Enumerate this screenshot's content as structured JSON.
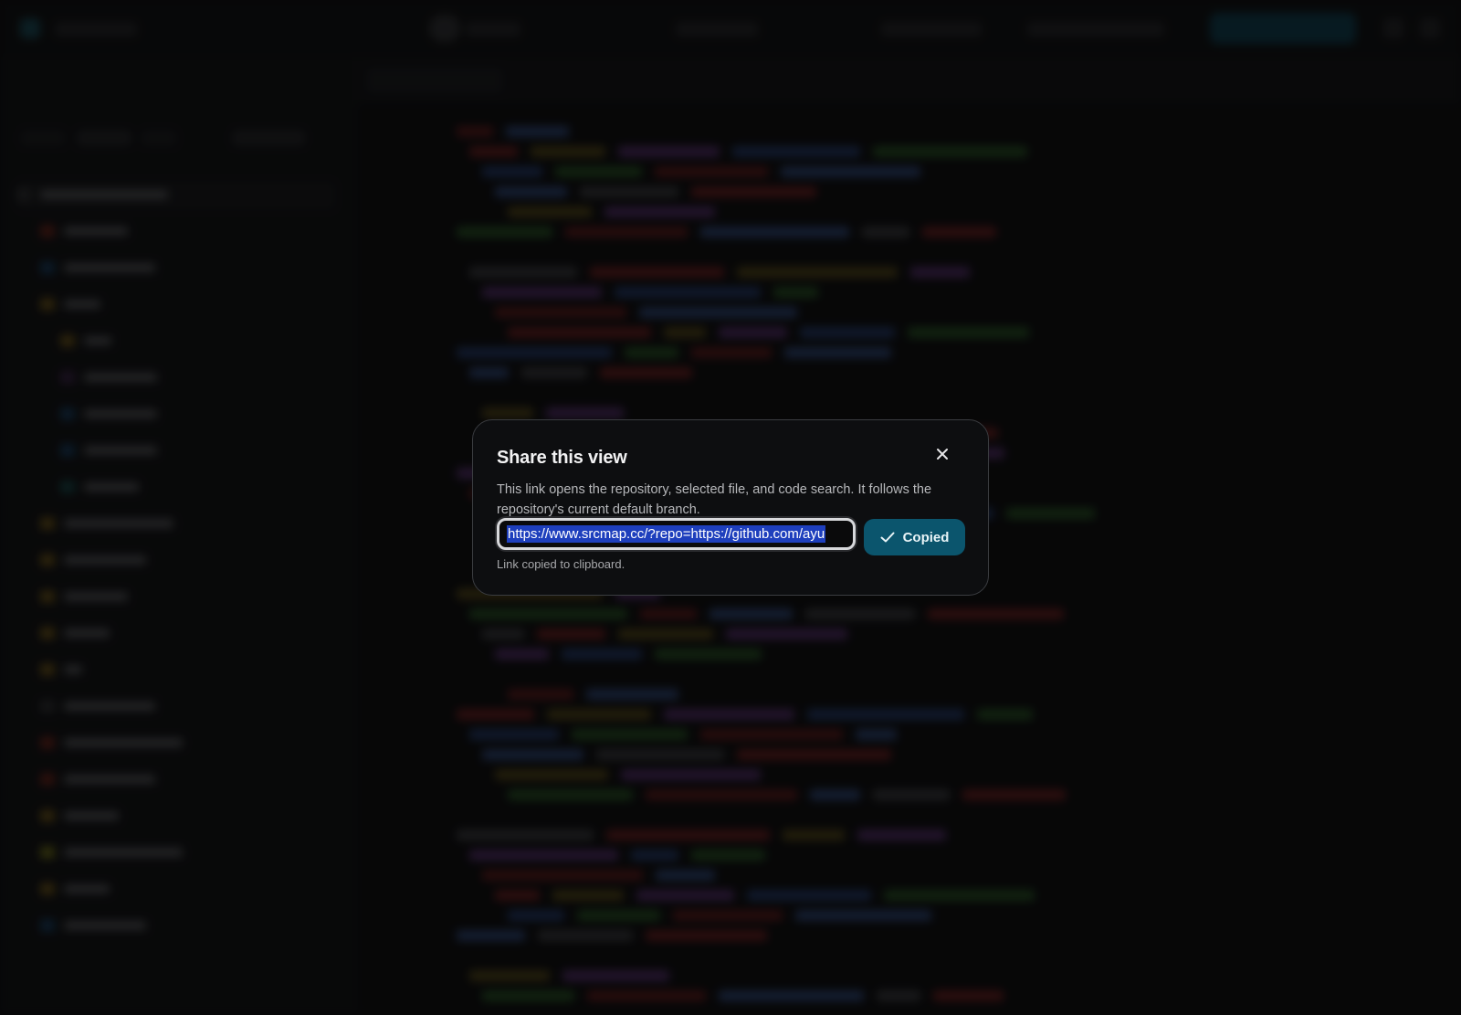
{
  "dialog": {
    "title": "Share this view",
    "description": "This link opens the repository, selected file, and code search. It follows the repository's current default branch.",
    "url_value": "https://www.srcmap.cc/?repo=https://github.com/ayu",
    "copied_button_label": "Copied",
    "status_text": "Link copied to clipboard.",
    "close_icon": "close-icon",
    "check_icon": "check-icon"
  },
  "colors": {
    "dialog_background": "#0d0e10",
    "accent_button": "#0b556d",
    "selection_highlight": "#1e3fbd"
  }
}
